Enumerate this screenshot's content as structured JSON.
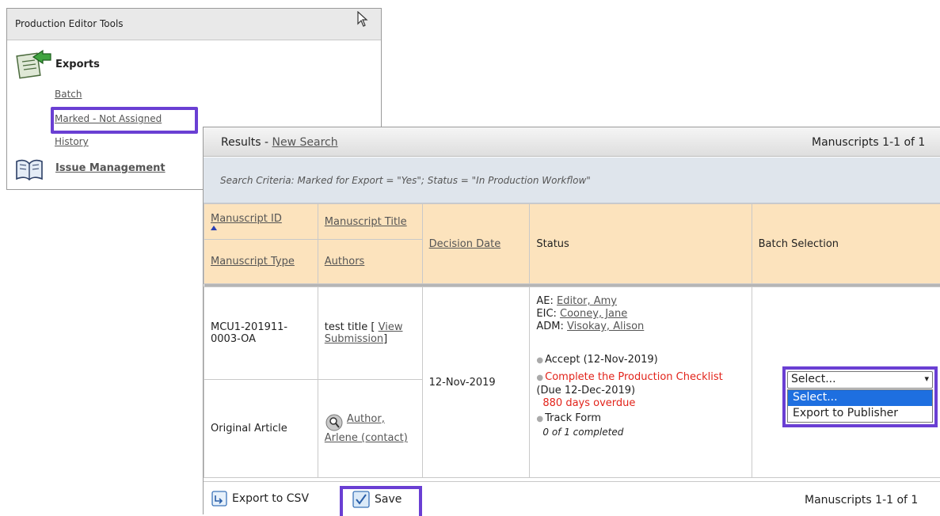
{
  "tools": {
    "header": "Production Editor Tools",
    "exports_title": "Exports",
    "links": [
      "Batch",
      "Marked - Not Assigned",
      "History"
    ],
    "issue_management": "Issue Management"
  },
  "results": {
    "label": "Results - ",
    "new_search": "New Search",
    "count": "Manuscripts 1-1 of 1",
    "criteria": "Search Criteria: Marked for Export = \"Yes\"; Status = \"In Production Workflow\"",
    "columns": {
      "manuscript_id": "Manuscript ID",
      "manuscript_title": "Manuscript Title",
      "manuscript_type": "Manuscript Type",
      "authors": "Authors",
      "decision_date": "Decision Date",
      "status": "Status",
      "batch_selection": "Batch Selection"
    },
    "row": {
      "manuscript_id": "MCU1-201911-0003-OA",
      "title": "test title [ ",
      "view_submission": "View Submission",
      "title_close": "]",
      "type": "Original Article",
      "author": "Author, Arlene (contact)",
      "decision_date": "12-Nov-2019",
      "ae_label": "AE: ",
      "ae_name": "Editor, Amy",
      "eic_label": "EIC: ",
      "eic_name": "Cooney, Jane",
      "adm_label": "ADM: ",
      "adm_name": "Visokay, Alison",
      "accept": "Accept (12-Nov-2019)",
      "checklist": "Complete the Production Checklist",
      "due": " (Due 12-Dec-2019)",
      "overdue": "880 days overdue",
      "track_form": "Track Form",
      "completed": "0 of 1 completed"
    },
    "select": {
      "value": "Select...",
      "options": [
        "Select...",
        "Export to Publisher"
      ]
    },
    "footer": {
      "export_csv": "Export to CSV",
      "save": "Save",
      "count": "Manuscripts 1-1 of 1"
    }
  },
  "colors": {
    "highlight": "#6a3fd3",
    "header_bg": "#fce3bd",
    "criteria_bg": "#dfe5ec",
    "overdue": "#e2231a",
    "selected_option": "#1e6fe0"
  }
}
